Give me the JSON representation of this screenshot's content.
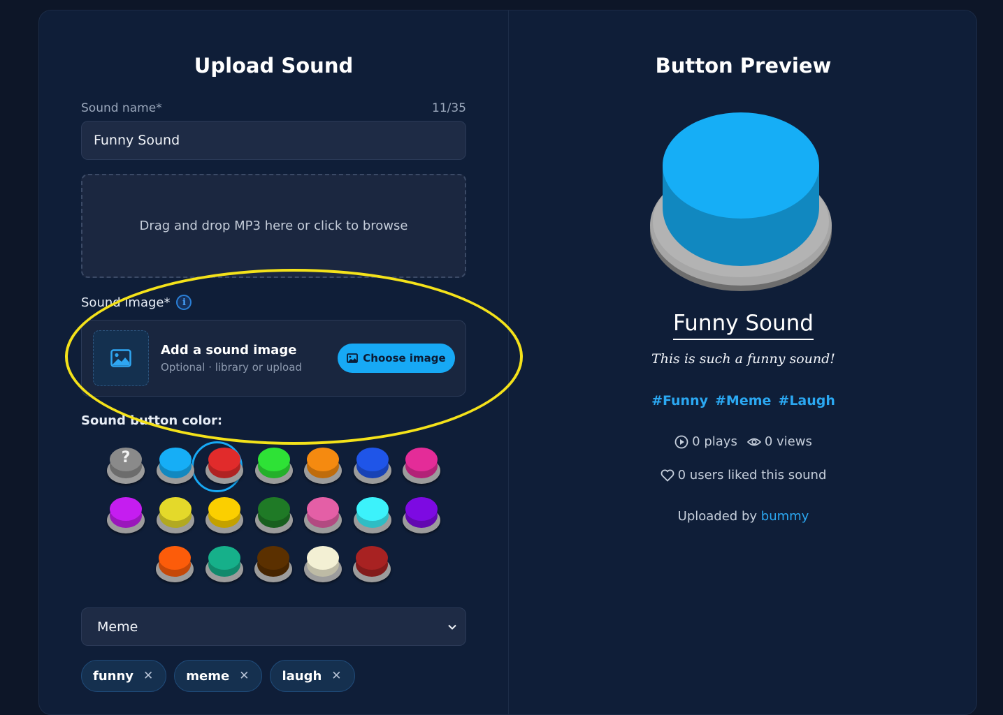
{
  "upload_panel": {
    "title": "Upload Sound",
    "name_label": "Sound name*",
    "name_counter": "11/35",
    "name_value": "Funny Sound",
    "dropzone_text": "Drag and drop MP3 here or click to browse",
    "image_label": "Sound image*",
    "info_icon": "i",
    "image_box": {
      "title": "Add a sound image",
      "subtitle": "Optional · library or upload",
      "choose_label": "Choose image"
    },
    "color_label": "Sound button color:",
    "color_options": [
      "#8a8a8a",
      "#16aef6",
      "#e12b2b",
      "#2ee236",
      "#f58a10",
      "#1f55e8",
      "#e42c98",
      "#c51df0",
      "#e4d92a",
      "#fbcf00",
      "#1f7a26",
      "#e45fa6",
      "#3cf2fb",
      "#7d0ae2",
      "#fc5c0a",
      "#16b08a",
      "#5b3000",
      "#f3f0d4",
      "#a82222"
    ],
    "unknown_color_glyph": "?",
    "selected_color_index": 1,
    "category_value": "Meme",
    "tags": [
      {
        "label": "funny",
        "remove": "✕"
      },
      {
        "label": "meme",
        "remove": "✕"
      },
      {
        "label": "laugh",
        "remove": "✕"
      }
    ]
  },
  "preview_panel": {
    "title": "Button Preview",
    "button_color": "#16aef6",
    "name": "Funny Sound",
    "description": "This is such a funny sound!",
    "hashtags": [
      "#Funny",
      "#Meme",
      "#Laugh"
    ],
    "plays": "0 plays",
    "views": "0 views",
    "likes": "0 users liked this sound",
    "uploaded_by_prefix": "Uploaded by",
    "uploader": "bummy"
  },
  "colors": {
    "background": "#0d1628",
    "card": "#0f1e38",
    "accent": "#17a9f5",
    "highlight": "#f4e21a"
  }
}
